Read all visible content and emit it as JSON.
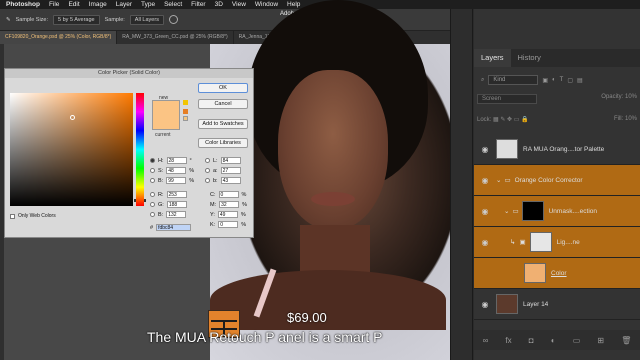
{
  "menubar": {
    "app": "Photoshop",
    "items": [
      "File",
      "Edit",
      "Image",
      "Layer",
      "Type",
      "Select",
      "Filter",
      "3D",
      "View",
      "Window",
      "Help"
    ]
  },
  "options_bar": {
    "sample_size_label": "Sample Size:",
    "sample_size_value": "5 by 5 Average",
    "sample_label": "Sample:",
    "sample_value": "All Layers",
    "window_title": "Adobe Photoshop 2020"
  },
  "doc_tabs": [
    "CF109820_Orange.psd @ 25% (Color, RGB/8*)",
    "RA_MW_373_Green_CC.psd @ 25% (RGB/8*)",
    "RA_Jenna_116_Purple.psd @ 40.7% (Background, RGB/8*)"
  ],
  "color_picker": {
    "title": "Color Picker (Solid Color)",
    "new_label": "new",
    "current_label": "current",
    "new_color": "#fbc484",
    "buttons": {
      "ok": "OK",
      "cancel": "Cancel",
      "add_swatches": "Add to Swatches",
      "libraries": "Color Libraries"
    },
    "hsb": {
      "H": "28",
      "S": "48",
      "B": "99"
    },
    "h_unit": "°",
    "pct": "%",
    "rgb": {
      "R": "253",
      "G": "188",
      "B": "132"
    },
    "lab": {
      "L": "84",
      "a": "27",
      "b": "43"
    },
    "cmyk": {
      "C": "0",
      "M": "32",
      "Y": "49",
      "K": "0"
    },
    "hex_label": "#",
    "hex": "fdbc84",
    "web_only": "Only Web Colors"
  },
  "overlay": {
    "price": "$69.00",
    "caption": "The MUA Retouch P anel is a smart P"
  },
  "layers_panel": {
    "tabs": [
      "Layers",
      "History"
    ],
    "kind_label": "Kind",
    "blend_mode": "Screen",
    "opacity_label": "Opacity:",
    "opacity_value": "10%",
    "lock_label": "Lock:",
    "fill_label": "Fill:",
    "fill_value": "10%",
    "layers": [
      {
        "name": "RA MUA Orang....tor Palette",
        "selected": false,
        "thumb": "#dddddd"
      },
      {
        "name": "Orange Color Corrector",
        "selected": true,
        "thumb": ""
      },
      {
        "name": "Unmask....ection",
        "selected": true,
        "thumb": "#000000"
      },
      {
        "name": "Lig....ne",
        "selected": true,
        "thumb": "#e6e6e6"
      },
      {
        "name": "Color",
        "selected": true,
        "thumb": "#f0b072"
      },
      {
        "name": "Layer 14",
        "selected": false,
        "thumb": "#5c3a2c"
      }
    ],
    "bottom_icons": [
      "link-icon",
      "fx-icon",
      "mask-icon",
      "adjustment-icon",
      "folder-icon",
      "new-layer-icon",
      "trash-icon"
    ]
  }
}
